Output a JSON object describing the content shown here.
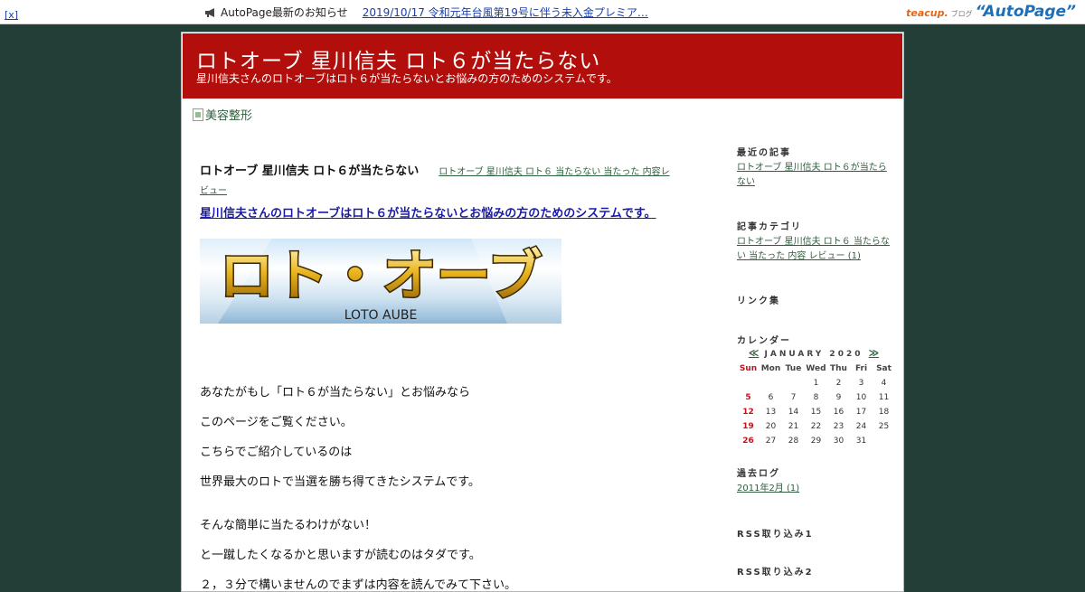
{
  "topbar": {
    "close_label": "[x]",
    "notice_label": "AutoPage最新のお知らせ",
    "notice_link": "2019/10/17 令和元年台風第19号に伴う未入金プレミア…",
    "brand_teacup": "teacup.",
    "brand_blog": "ブログ",
    "brand_autopage": "“AutoPage”"
  },
  "header": {
    "title": "ロトオーブ 星川信夫 ロト６が当たらない",
    "description": "星川信夫さんのロトオーブはロト６が当たらないとお悩みの方のためのシステムです。"
  },
  "banner": {
    "alt_text": "美容整形"
  },
  "entry": {
    "title": "ロトオーブ 星川信夫 ロト６が当たらない",
    "category_link": "ロトオーブ 星川信夫 ロト６ 当たらない 当たった 内容レビュー",
    "headline_link": "星川信夫さんのロトオーブはロト６が当たらないとお悩みの方のためのシステムです。",
    "logo_text": "ロト・オーブ",
    "logo_sub": "LOTO AUBE",
    "paragraphs": [
      "あなたがもし「ロト６が当たらない」とお悩みなら",
      "このページをご覧ください。",
      "こちらでご紹介しているのは",
      "世界最大のロトで当選を勝ち得てきたシステムです。",
      "そんな簡単に当たるわけがない！",
      "と一蹴したくなるかと思いますが読むのはタダです。",
      "２，３分で構いませんのでまずは内容を読んでみて下さい。"
    ]
  },
  "sidebar": {
    "recent_heading": "最近の記事",
    "recent_link": "ロトオーブ 星川信夫 ロト６が当たらない",
    "category_heading": "記事カテゴリ",
    "category_link": "ロトオーブ 星川信夫 ロト６ 当たらない 当たった 内容 レビュー (1)",
    "links_heading": "リンク集",
    "calendar_heading": "カレンダー",
    "archive_heading": "過去ログ",
    "archive_link": "2011年2月 (1)",
    "rss1_heading": "RSS取り込み1",
    "rss2_heading": "RSS取り込み2"
  },
  "calendar": {
    "prev": "≪",
    "next": "≫",
    "month": "JANUARY 2020",
    "days": [
      "Sun",
      "Mon",
      "Tue",
      "Wed",
      "Thu",
      "Fri",
      "Sat"
    ],
    "weeks": [
      [
        "",
        "",
        "",
        "1",
        "2",
        "3",
        "4"
      ],
      [
        "5",
        "6",
        "7",
        "8",
        "9",
        "10",
        "11"
      ],
      [
        "12",
        "13",
        "14",
        "15",
        "16",
        "17",
        "18"
      ],
      [
        "19",
        "20",
        "21",
        "22",
        "23",
        "24",
        "25"
      ],
      [
        "26",
        "27",
        "28",
        "29",
        "30",
        "31",
        ""
      ]
    ]
  },
  "colors": {
    "page_bg": "#233d37",
    "header_bg": "#b20f0c",
    "link_green": "#2d5f3d",
    "link_blue": "#1a3ea8",
    "sunday_red": "#c8101a"
  }
}
